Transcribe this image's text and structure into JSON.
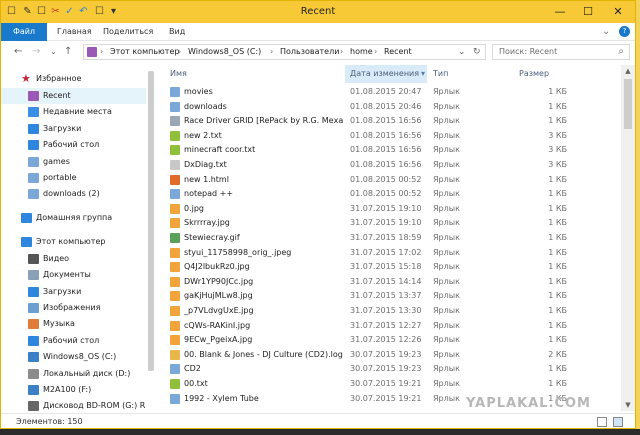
{
  "window": {
    "title": "Recent",
    "controls": [
      "—",
      "☐",
      "✕"
    ]
  },
  "quick_access": [
    "☐",
    "✎",
    "☐",
    "✂",
    "✓",
    "↶",
    "☐",
    "▾"
  ],
  "ribbon": {
    "tabs": [
      "Файл",
      "Главная",
      "Поделиться",
      "Вид"
    ],
    "expand": "⌄",
    "help": "?"
  },
  "address": {
    "back": "←",
    "forward": "→",
    "up": "↑",
    "dropdown": "⌄",
    "refresh": "↻",
    "crumbs": [
      "Этот компьютер",
      "Windows8_OS (C:)",
      "Пользователи",
      "home",
      "Recent"
    ],
    "sep": "›",
    "search_placeholder": "Поиск: Recent",
    "search_icon": "⌕"
  },
  "nav": [
    {
      "label": "Избранное",
      "icon": "star-icon",
      "color": "#c2263d",
      "indent": 0,
      "group": true
    },
    {
      "label": "Recent",
      "icon": "recent-icon",
      "color": "#9b59b6",
      "indent": 1,
      "selected": true
    },
    {
      "label": "Недавние места",
      "icon": "places-icon",
      "color": "#3a8ee6",
      "indent": 1
    },
    {
      "label": "Загрузки",
      "icon": "downloads-icon",
      "color": "#2e86de",
      "indent": 1
    },
    {
      "label": "Рабочий стол",
      "icon": "desktop-icon",
      "color": "#2e86de",
      "indent": 1
    },
    {
      "label": "games",
      "icon": "folder-icon",
      "color": "#7aa9d9",
      "indent": 1
    },
    {
      "label": "portable",
      "icon": "folder-icon",
      "color": "#7aa9d9",
      "indent": 1
    },
    {
      "label": "downloads (2)",
      "icon": "folder-icon",
      "color": "#7aa9d9",
      "indent": 1
    },
    {
      "label": "",
      "spacer": true
    },
    {
      "label": "Домашняя группа",
      "icon": "homegroup-icon",
      "color": "#2e86de",
      "indent": 0,
      "group": true
    },
    {
      "label": "",
      "spacer": true
    },
    {
      "label": "Этот компьютер",
      "icon": "computer-icon",
      "color": "#2e86de",
      "indent": 0,
      "group": true
    },
    {
      "label": "Видео",
      "icon": "video-icon",
      "color": "#555555",
      "indent": 1
    },
    {
      "label": "Документы",
      "icon": "documents-icon",
      "color": "#8aa0b8",
      "indent": 1
    },
    {
      "label": "Загрузки",
      "icon": "downloads-icon",
      "color": "#2e86de",
      "indent": 1
    },
    {
      "label": "Изображения",
      "icon": "pictures-icon",
      "color": "#6b9fcf",
      "indent": 1
    },
    {
      "label": "Музыка",
      "icon": "music-icon",
      "color": "#e07b39",
      "indent": 1
    },
    {
      "label": "Рабочий стол",
      "icon": "desktop-icon",
      "color": "#2e86de",
      "indent": 1
    },
    {
      "label": "Windows8_OS (C:)",
      "icon": "drive-icon",
      "color": "#3b7fc4",
      "indent": 1
    },
    {
      "label": "Локальный диск (D:)",
      "icon": "drive-icon",
      "color": "#8b8b8b",
      "indent": 1
    },
    {
      "label": "M2A100 (F:)",
      "icon": "drive-icon",
      "color": "#3b7fc4",
      "indent": 1
    },
    {
      "label": "Дисковод BD-ROM (G:) RD",
      "icon": "disc-icon",
      "color": "#666666",
      "indent": 1
    }
  ],
  "columns": {
    "name": "Имя",
    "date": "Дата изменения",
    "type": "Тип",
    "size": "Размер",
    "sort_indicator": "⌃"
  },
  "files": [
    {
      "name": "movies",
      "date": "01.08.2015 20:47",
      "type": "Ярлык",
      "size": "1 КБ",
      "icon": "folder-shortcut-icon",
      "color": "#7aa9d9"
    },
    {
      "name": "downloads",
      "date": "01.08.2015 20:46",
      "type": "Ярлык",
      "size": "1 КБ",
      "icon": "folder-shortcut-icon",
      "color": "#7aa9d9"
    },
    {
      "name": "Race Driver GRID [RePack by R.G. Механ...",
      "date": "01.08.2015 16:56",
      "type": "Ярлык",
      "size": "1 КБ",
      "icon": "shortcut-icon",
      "color": "#9aa8b5"
    },
    {
      "name": "new  2.txt",
      "date": "01.08.2015 16:56",
      "type": "Ярлык",
      "size": "3 КБ",
      "icon": "notepadpp-icon",
      "color": "#8fbf3b"
    },
    {
      "name": "minecraft  coor.txt",
      "date": "01.08.2015 16:56",
      "type": "Ярлык",
      "size": "3 КБ",
      "icon": "notepadpp-icon",
      "color": "#8fbf3b"
    },
    {
      "name": "DxDiag.txt",
      "date": "01.08.2015 16:56",
      "type": "Ярлык",
      "size": "3 КБ",
      "icon": "text-file-icon",
      "color": "#c8c8c8"
    },
    {
      "name": "new  1.html",
      "date": "01.08.2015 00:52",
      "type": "Ярлык",
      "size": "1 КБ",
      "icon": "html-icon",
      "color": "#e06b2a"
    },
    {
      "name": "notepad ++",
      "date": "01.08.2015 00:52",
      "type": "Ярлык",
      "size": "1 КБ",
      "icon": "folder-shortcut-icon",
      "color": "#7aa9d9"
    },
    {
      "name": "0.jpg",
      "date": "31.07.2015 19:10",
      "type": "Ярлык",
      "size": "1 КБ",
      "icon": "image-icon",
      "color": "#f2a33a"
    },
    {
      "name": "Skrrrray.jpg",
      "date": "31.07.2015 19:10",
      "type": "Ярлык",
      "size": "1 КБ",
      "icon": "image-icon",
      "color": "#f2a33a"
    },
    {
      "name": "Stewiecray.gif",
      "date": "31.07.2015 18:59",
      "type": "Ярлык",
      "size": "1 КБ",
      "icon": "gif-icon",
      "color": "#5aa05a"
    },
    {
      "name": "styui_11758998_orig_.jpeg",
      "date": "31.07.2015 17:02",
      "type": "Ярлык",
      "size": "1 КБ",
      "icon": "image-icon",
      "color": "#f2a33a"
    },
    {
      "name": "Q4J2lbukRz0.jpg",
      "date": "31.07.2015 15:18",
      "type": "Ярлык",
      "size": "1 КБ",
      "icon": "image-icon",
      "color": "#f2a33a"
    },
    {
      "name": "DWr1YP90JCc.jpg",
      "date": "31.07.2015 14:14",
      "type": "Ярлык",
      "size": "1 КБ",
      "icon": "image-icon",
      "color": "#f2a33a"
    },
    {
      "name": "gaKjHujMLw8.jpg",
      "date": "31.07.2015 13:37",
      "type": "Ярлык",
      "size": "1 КБ",
      "icon": "image-icon",
      "color": "#f2a33a"
    },
    {
      "name": "_p7VLdvgUxE.jpg",
      "date": "31.07.2015 13:30",
      "type": "Ярлык",
      "size": "1 КБ",
      "icon": "image-icon",
      "color": "#f2a33a"
    },
    {
      "name": "cQWs-RAKinI.jpg",
      "date": "31.07.2015 12:27",
      "type": "Ярлык",
      "size": "1 КБ",
      "icon": "image-icon",
      "color": "#f2a33a"
    },
    {
      "name": "9ECw_PgeixA.jpg",
      "date": "31.07.2015 12:26",
      "type": "Ярлык",
      "size": "1 КБ",
      "icon": "image-icon",
      "color": "#f2a33a"
    },
    {
      "name": "00. Blank & Jones - DJ Culture (CD2).log",
      "date": "30.07.2015 19:23",
      "type": "Ярлык",
      "size": "2 КБ",
      "icon": "log-icon",
      "color": "#e8b84a"
    },
    {
      "name": "CD2",
      "date": "30.07.2015 19:23",
      "type": "Ярлык",
      "size": "1 КБ",
      "icon": "folder-shortcut-icon",
      "color": "#7aa9d9"
    },
    {
      "name": "00.txt",
      "date": "30.07.2015 19:21",
      "type": "Ярлык",
      "size": "1 КБ",
      "icon": "notepadpp-icon",
      "color": "#8fbf3b"
    },
    {
      "name": "1992 - Xylem Tube",
      "date": "30.07.2015 19:21",
      "type": "Ярлык",
      "size": "1 КБ",
      "icon": "folder-shortcut-icon",
      "color": "#7aa9d9"
    }
  ],
  "status": {
    "count": "Элементов: 150"
  },
  "watermark": "YAPLAKAL.COM"
}
